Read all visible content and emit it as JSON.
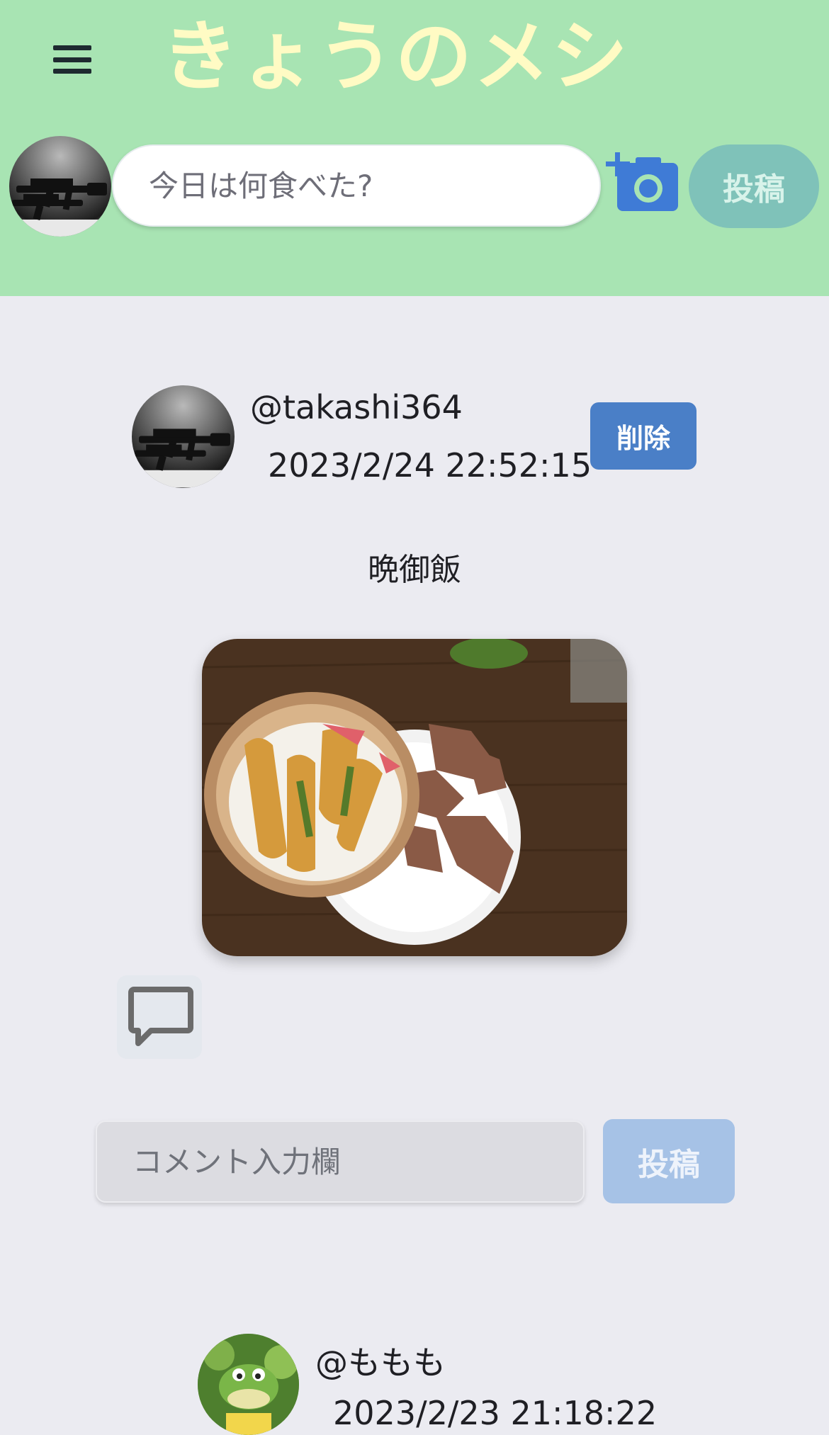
{
  "header": {
    "app_title": "きょうのメシ",
    "post_placeholder": "今日は何食べた?",
    "post_button_label": "投稿",
    "menu_icon": "hamburger-menu-icon",
    "camera_icon": "add-photo-camera-icon",
    "colors": {
      "background": "#a8e4b3",
      "title": "#fffbc4",
      "post_button": "#7fc2b9"
    }
  },
  "posts": [
    {
      "username": "@takashi364",
      "timestamp": "2023/2/24 22:52:15",
      "delete_label": "削除",
      "caption": "晩御飯",
      "comment_icon": "comment-bubble-icon",
      "comment_placeholder": "コメント入力欄",
      "comment_submit_label": "投稿"
    },
    {
      "username": "@ももも",
      "timestamp": "2023/2/23 21:18:22"
    }
  ],
  "colors": {
    "page_background": "#ebebf1",
    "delete_button": "#4a7fc7",
    "comment_submit": "#a6c2e6"
  }
}
